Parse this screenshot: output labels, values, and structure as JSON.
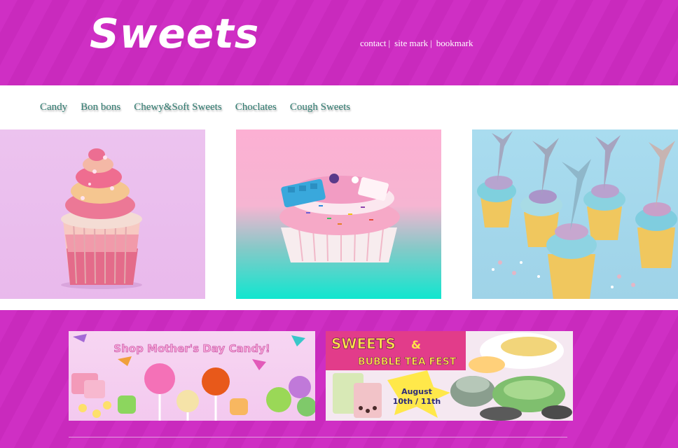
{
  "brand": {
    "logo_text": "Sweets"
  },
  "top_links": [
    {
      "label": "contact",
      "sep": "|"
    },
    {
      "label": "site mark",
      "sep": "|"
    },
    {
      "label": "bookmark",
      "sep": ""
    }
  ],
  "nav": {
    "items": [
      "Candy",
      "Bon bons",
      "Chewy&Soft Sweets",
      "Choclates",
      "Cough Sweets"
    ]
  },
  "banners": {
    "mothers_day": {
      "title": "Shop Mother's Day Candy!"
    },
    "fest": {
      "line1": "SWEETS",
      "amp": "&",
      "line2": "BUBBLE TEA FEST",
      "date_line1": "August",
      "date_line2": "10th / 11th"
    }
  },
  "colors": {
    "accent": "#cf2fc4",
    "nav_text": "#2f7b70"
  }
}
